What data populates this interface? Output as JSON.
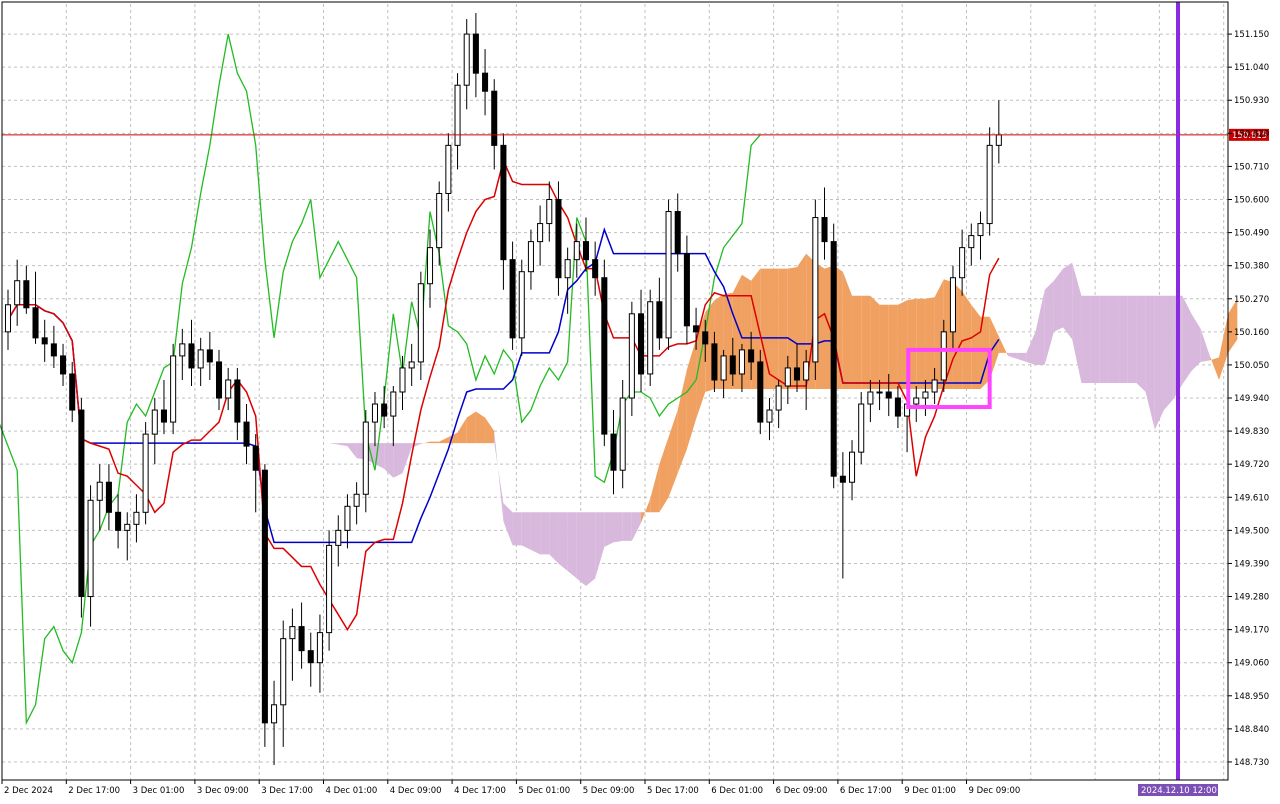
{
  "chart_data": {
    "type": "candlestick",
    "symbol_price_current": "150.815",
    "y_ticks": [
      "151.150",
      "151.040",
      "150.930",
      "150.820",
      "150.710",
      "150.600",
      "150.490",
      "150.380",
      "150.270",
      "150.160",
      "150.050",
      "149.940",
      "149.830",
      "149.720",
      "149.610",
      "149.500",
      "149.390",
      "149.280",
      "149.170",
      "149.060",
      "148.950",
      "148.840",
      "148.730"
    ],
    "x_ticks": [
      "2 Dec 2024",
      "2 Dec 17:00",
      "3 Dec 01:00",
      "3 Dec 09:00",
      "3 Dec 17:00",
      "4 Dec 01:00",
      "4 Dec 09:00",
      "4 Dec 17:00",
      "5 Dec 01:00",
      "5 Dec 09:00",
      "5 Dec 17:00",
      "6 Dec 01:00",
      "6 Dec 09:00",
      "6 Dec 17:00",
      "9 Dec 01:00",
      "9 Dec 09:00"
    ],
    "future_time_label": "2024.12.10 12:00",
    "ylim": [
      148.67,
      151.25
    ],
    "grid": true,
    "colors": {
      "bull_body": "#ffffff",
      "bear_body": "#000000",
      "tenkan": "#dd0000",
      "kijun": "#0000cc",
      "chikou": "#22bb22",
      "cloud_bear": "#d8b8dc",
      "cloud_bull": "#f0a060",
      "current_price_line": "#cc0000",
      "current_price_badge": "#cc0000",
      "vertical_marker": "#8a2be2",
      "highlight_box": "#ff44ff",
      "future_label_bg": "#7b4fb5"
    },
    "candles": [
      [
        150.16,
        150.3,
        150.1,
        150.25
      ],
      [
        150.25,
        150.4,
        150.18,
        150.33
      ],
      [
        150.33,
        150.38,
        150.22,
        150.24
      ],
      [
        150.24,
        150.36,
        150.12,
        150.14
      ],
      [
        150.14,
        150.2,
        150.06,
        150.12
      ],
      [
        150.12,
        150.18,
        150.04,
        150.08
      ],
      [
        150.08,
        150.12,
        149.98,
        150.02
      ],
      [
        150.02,
        150.06,
        149.86,
        149.9
      ],
      [
        149.9,
        149.94,
        149.21,
        149.28
      ],
      [
        149.28,
        149.65,
        149.18,
        149.6
      ],
      [
        149.6,
        149.72,
        149.5,
        149.66
      ],
      [
        149.66,
        149.72,
        149.5,
        149.56
      ],
      [
        149.56,
        149.62,
        149.44,
        149.5
      ],
      [
        149.5,
        149.56,
        149.4,
        149.52
      ],
      [
        149.52,
        149.62,
        149.46,
        149.56
      ],
      [
        149.56,
        149.86,
        149.52,
        149.82
      ],
      [
        149.82,
        149.94,
        149.72,
        149.9
      ],
      [
        149.9,
        150.0,
        149.82,
        149.86
      ],
      [
        149.86,
        150.12,
        149.82,
        150.08
      ],
      [
        150.08,
        150.17,
        150.0,
        150.12
      ],
      [
        150.12,
        150.2,
        149.98,
        150.04
      ],
      [
        150.04,
        150.14,
        149.98,
        150.1
      ],
      [
        150.1,
        150.16,
        150.0,
        150.06
      ],
      [
        150.06,
        150.1,
        149.9,
        149.94
      ],
      [
        149.94,
        150.04,
        149.9,
        150.0
      ],
      [
        150.0,
        150.04,
        149.8,
        149.86
      ],
      [
        149.86,
        149.92,
        149.72,
        149.78
      ],
      [
        149.78,
        149.82,
        149.56,
        149.7
      ],
      [
        149.7,
        149.72,
        148.78,
        148.86
      ],
      [
        148.86,
        149.0,
        148.72,
        148.92
      ],
      [
        148.92,
        149.2,
        148.78,
        149.14
      ],
      [
        149.14,
        149.24,
        149.0,
        149.18
      ],
      [
        149.18,
        149.26,
        149.04,
        149.1
      ],
      [
        149.1,
        149.16,
        148.98,
        149.06
      ],
      [
        149.06,
        149.22,
        148.96,
        149.16
      ],
      [
        149.16,
        149.5,
        149.1,
        149.45
      ],
      [
        149.45,
        149.55,
        149.38,
        149.5
      ],
      [
        149.5,
        149.62,
        149.44,
        149.58
      ],
      [
        149.58,
        149.66,
        149.52,
        149.62
      ],
      [
        149.62,
        149.9,
        149.56,
        149.86
      ],
      [
        149.86,
        149.96,
        149.78,
        149.92
      ],
      [
        149.92,
        149.98,
        149.84,
        149.88
      ],
      [
        149.88,
        149.98,
        149.78,
        149.96
      ],
      [
        149.96,
        150.08,
        149.9,
        150.04
      ],
      [
        150.04,
        150.12,
        149.98,
        150.06
      ],
      [
        150.06,
        150.36,
        150.0,
        150.32
      ],
      [
        150.32,
        150.5,
        150.24,
        150.44
      ],
      [
        150.44,
        150.66,
        150.38,
        150.62
      ],
      [
        150.62,
        150.82,
        150.56,
        150.78
      ],
      [
        150.78,
        151.02,
        150.7,
        150.98
      ],
      [
        150.98,
        151.2,
        150.9,
        151.15
      ],
      [
        151.15,
        151.22,
        150.94,
        151.02
      ],
      [
        151.02,
        151.1,
        150.88,
        150.96
      ],
      [
        150.96,
        151.0,
        150.7,
        150.78
      ],
      [
        150.78,
        150.82,
        150.3,
        150.4
      ],
      [
        150.4,
        150.46,
        150.1,
        150.14
      ],
      [
        150.14,
        150.4,
        150.08,
        150.36
      ],
      [
        150.36,
        150.5,
        150.3,
        150.46
      ],
      [
        150.46,
        150.58,
        150.38,
        150.52
      ],
      [
        150.52,
        150.66,
        150.46,
        150.6
      ],
      [
        150.6,
        150.66,
        150.28,
        150.34
      ],
      [
        150.34,
        150.44,
        150.22,
        150.4
      ],
      [
        150.4,
        150.52,
        150.34,
        150.46
      ],
      [
        150.46,
        150.54,
        150.36,
        150.4
      ],
      [
        150.4,
        150.46,
        150.28,
        150.34
      ],
      [
        150.34,
        150.4,
        149.78,
        149.82
      ],
      [
        149.82,
        149.9,
        149.62,
        149.7
      ],
      [
        149.7,
        150.0,
        149.64,
        149.94
      ],
      [
        149.94,
        150.26,
        149.88,
        150.22
      ],
      [
        150.22,
        150.3,
        149.96,
        150.02
      ],
      [
        150.02,
        150.3,
        149.98,
        150.26
      ],
      [
        150.26,
        150.34,
        150.1,
        150.14
      ],
      [
        150.14,
        150.6,
        150.1,
        150.56
      ],
      [
        150.56,
        150.62,
        150.36,
        150.42
      ],
      [
        150.42,
        150.48,
        150.12,
        150.18
      ],
      [
        150.18,
        150.24,
        150.1,
        150.16
      ],
      [
        150.16,
        150.2,
        150.06,
        150.12
      ],
      [
        150.12,
        150.16,
        149.96,
        150.0
      ],
      [
        150.0,
        150.1,
        149.94,
        150.08
      ],
      [
        150.08,
        150.14,
        149.98,
        150.02
      ],
      [
        150.02,
        150.12,
        149.96,
        150.1
      ],
      [
        150.1,
        150.16,
        150.0,
        150.06
      ],
      [
        150.06,
        150.1,
        149.82,
        149.86
      ],
      [
        149.86,
        149.94,
        149.8,
        149.9
      ],
      [
        149.9,
        150.0,
        149.84,
        149.98
      ],
      [
        149.98,
        150.08,
        149.92,
        150.04
      ],
      [
        150.04,
        150.12,
        149.96,
        150.0
      ],
      [
        150.0,
        150.1,
        149.9,
        150.06
      ],
      [
        150.06,
        150.6,
        150.0,
        150.54
      ],
      [
        150.54,
        150.64,
        150.4,
        150.46
      ],
      [
        150.46,
        150.52,
        149.64,
        149.68
      ],
      [
        149.68,
        149.76,
        149.34,
        149.66
      ],
      [
        149.66,
        149.8,
        149.6,
        149.76
      ],
      [
        149.76,
        149.96,
        149.72,
        149.92
      ],
      [
        149.92,
        150.0,
        149.86,
        149.96
      ],
      [
        149.96,
        150.0,
        149.9,
        149.96
      ],
      [
        149.96,
        150.02,
        149.88,
        149.94
      ],
      [
        149.94,
        149.98,
        149.84,
        149.88
      ],
      [
        149.88,
        149.96,
        149.76,
        149.92
      ],
      [
        149.92,
        149.98,
        149.86,
        149.94
      ],
      [
        149.94,
        150.0,
        149.88,
        149.96
      ],
      [
        149.96,
        150.04,
        149.92,
        150.0
      ],
      [
        150.0,
        150.2,
        149.96,
        150.16
      ],
      [
        150.16,
        150.38,
        150.1,
        150.34
      ],
      [
        150.34,
        150.5,
        150.28,
        150.44
      ],
      [
        150.44,
        150.52,
        150.38,
        150.48
      ],
      [
        150.48,
        150.56,
        150.4,
        150.52
      ],
      [
        150.52,
        150.84,
        150.48,
        150.78
      ],
      [
        150.78,
        150.93,
        150.72,
        150.815
      ]
    ]
  }
}
